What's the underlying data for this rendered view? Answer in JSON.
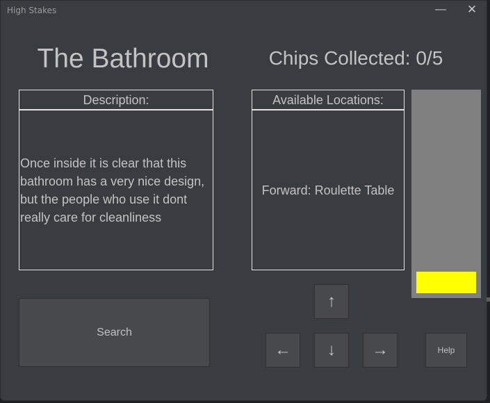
{
  "window": {
    "title": "High Stakes",
    "minimize_glyph": "—",
    "close_glyph": "✕"
  },
  "location": {
    "name": "The Bathroom"
  },
  "chips": {
    "label": "Chips Collected: 0/5",
    "collected": 0,
    "total": 5,
    "meter_fill_fraction": 0.11,
    "meter_color": "#808080",
    "fill_color": "#ffff00"
  },
  "description": {
    "header": "Description:",
    "text": "Once inside it is clear that this bathroom has a very nice design, but the people who use it dont really care for cleanliness"
  },
  "locations": {
    "header": "Available Locations:",
    "text": "Forward: Roulette Table"
  },
  "controls": {
    "search_label": "Search",
    "up_icon": "up-arrow-icon",
    "up_glyph": "↑",
    "left_icon": "left-arrow-icon",
    "left_glyph": "←",
    "down_icon": "down-arrow-icon",
    "down_glyph": "↓",
    "right_icon": "right-arrow-icon",
    "right_glyph": "→",
    "help_label": "Help"
  },
  "colors": {
    "background": "#393c40",
    "text": "#c3c3c3",
    "border": "#e6e6e6",
    "button": "#48494c"
  }
}
